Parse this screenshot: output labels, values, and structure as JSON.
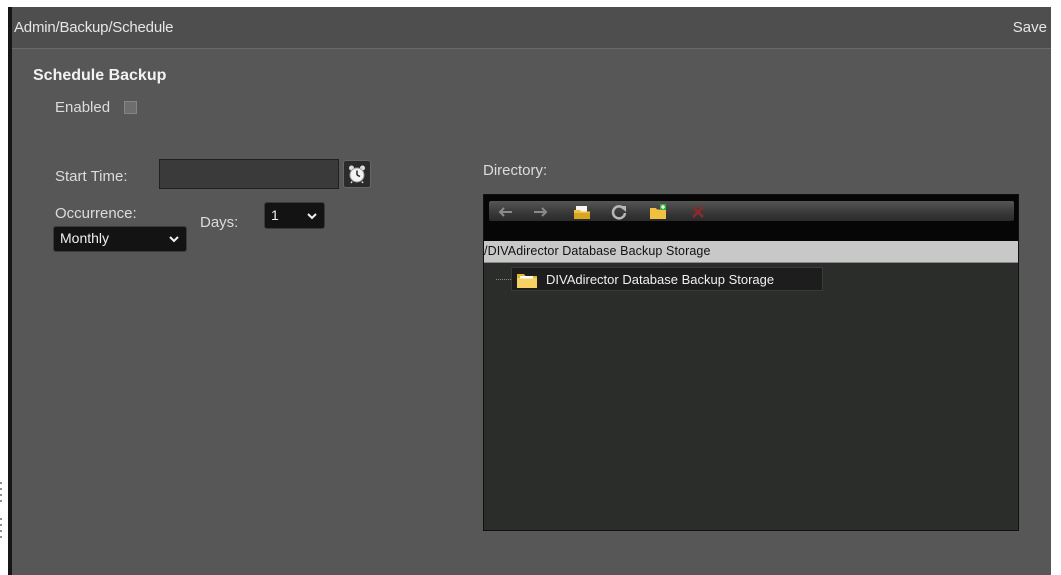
{
  "header": {
    "breadcrumb": "Admin/Backup/Schedule",
    "save_label": "Save"
  },
  "section": {
    "title": "Schedule Backup"
  },
  "form": {
    "enabled_label": "Enabled",
    "enabled": false,
    "start_time_label": "Start Time:",
    "start_time_value": "",
    "occurrence_label": "Occurrence:",
    "occurrence_value": "Monthly",
    "days_label": "Days:",
    "days_value": "1"
  },
  "directory": {
    "label": "Directory:",
    "current_path": "/DIVAdirector Database Backup Storage",
    "tree": [
      {
        "label": "DIVAdirector Database Backup Storage"
      }
    ],
    "toolbar": [
      "back-arrow-icon",
      "forward-arrow-icon",
      "open-folder-icon",
      "refresh-icon",
      "new-folder-icon",
      "delete-icon"
    ]
  },
  "colors": {
    "panel": "#575757",
    "header": "#4e4e4e",
    "select_bg": "#131313",
    "path_bar": "#c8c8c8",
    "delete": "#8e2a2a",
    "folder": "#f0c040"
  }
}
